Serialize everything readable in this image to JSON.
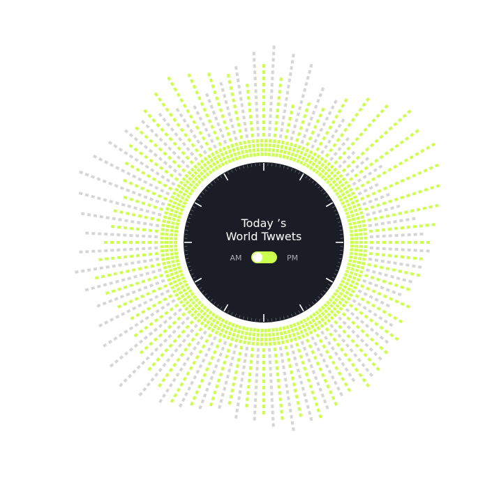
{
  "dial": {
    "title_line1": "Today ’s",
    "title_line2": "World Twwets",
    "toggle_left": "AM",
    "toggle_right": "PM",
    "toggle_on": true
  },
  "colors": {
    "dial_bg": "#1b1d26",
    "accent": "#ccff4d",
    "muted": "#d6d6d6",
    "text": "#ffffff",
    "text_dim": "#a9aab0",
    "knob": "#ffffff"
  },
  "chart_data": {
    "type": "radial-bar",
    "ring_levels": 4,
    "series": [
      {
        "color": "accent",
        "values": [
          12,
          10,
          6,
          7,
          7,
          10,
          12,
          13,
          15,
          14,
          15,
          14,
          13,
          12,
          11,
          10,
          9,
          9,
          8,
          9,
          9,
          10,
          10,
          11,
          12,
          11,
          12,
          13,
          12,
          12,
          11,
          10,
          10,
          11,
          12,
          13,
          12,
          11,
          10,
          9,
          8,
          9,
          10,
          11,
          10,
          9,
          8,
          8,
          7,
          8,
          9,
          10,
          11,
          12,
          13,
          14,
          13,
          12,
          11,
          9
        ]
      },
      {
        "color": "muted",
        "values": [
          15,
          14,
          13,
          10,
          9,
          7,
          5,
          4,
          5,
          6,
          4,
          5,
          6,
          8,
          9,
          10,
          9,
          8,
          7,
          6,
          8,
          9,
          10,
          11,
          10,
          11,
          12,
          13,
          14,
          13,
          12,
          12,
          11,
          12,
          13,
          14,
          15,
          16,
          15,
          14,
          13,
          12,
          13,
          14,
          13,
          12,
          13,
          14,
          15,
          14,
          13,
          12,
          11,
          10,
          9,
          8,
          9,
          10,
          12,
          14
        ]
      }
    ]
  }
}
